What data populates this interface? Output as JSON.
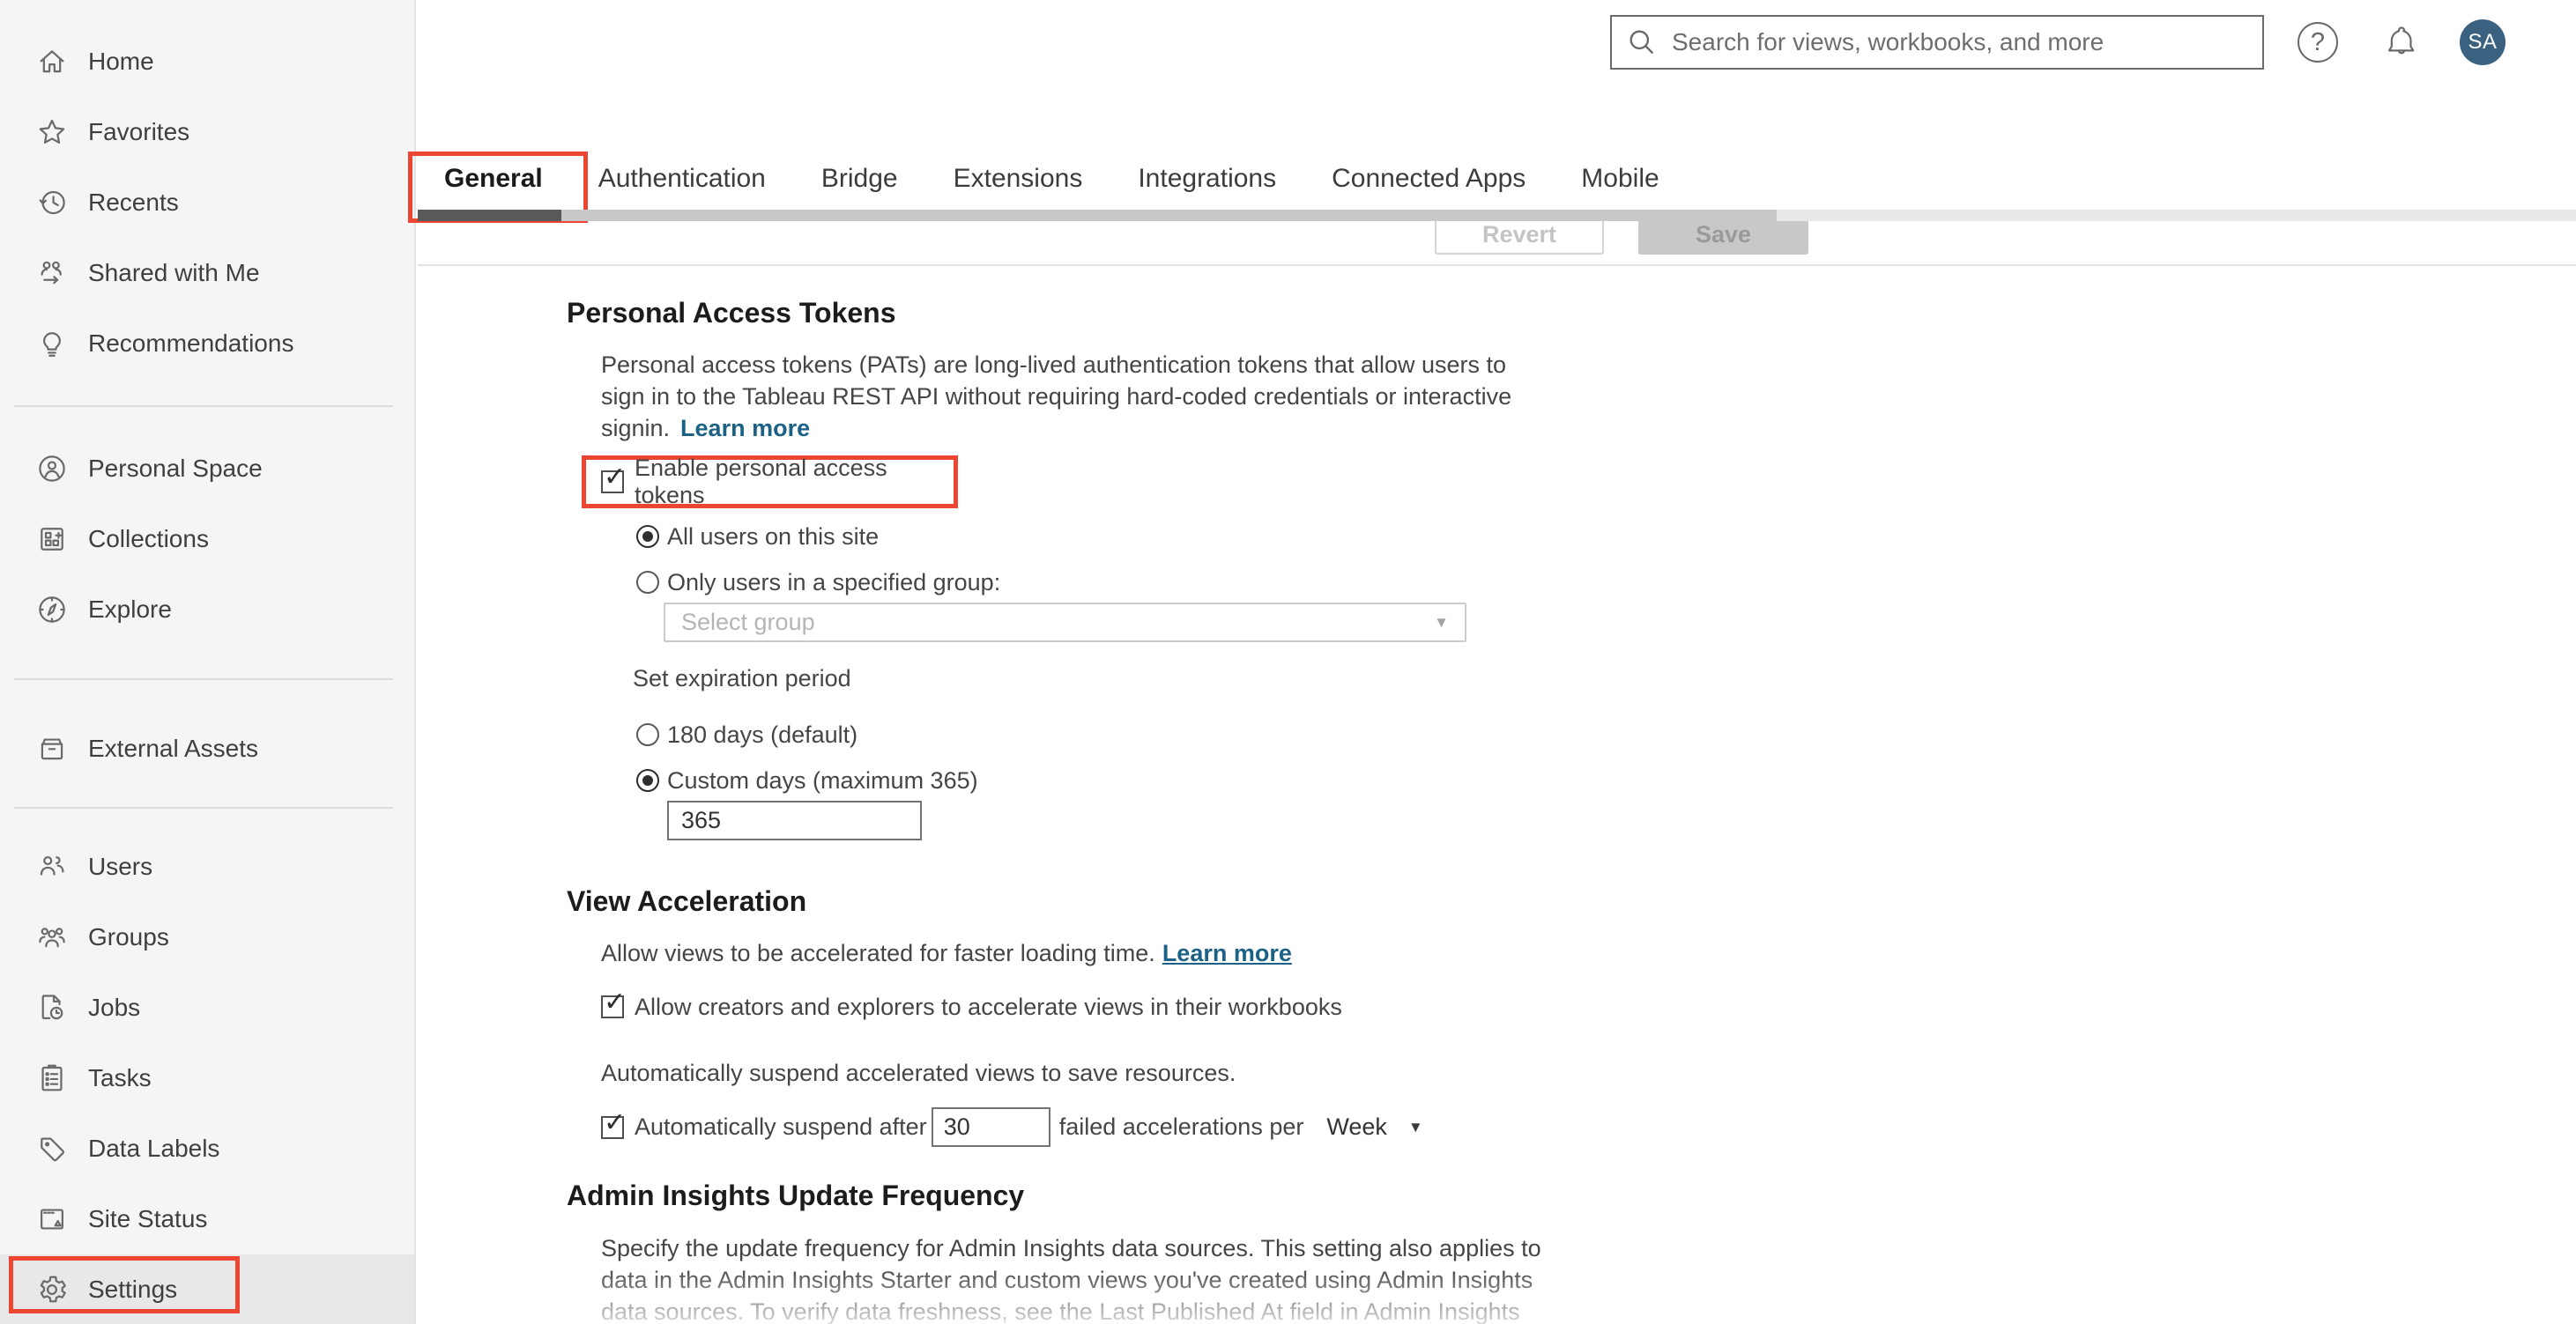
{
  "header": {
    "search_placeholder": "Search for views, workbooks, and more",
    "avatar_initials": "SA",
    "help_glyph": "?"
  },
  "icons": {
    "check": "✓",
    "caret_down": "▼"
  },
  "colors": {
    "annotation_red": "#ec4632",
    "link_blue": "#1c6286",
    "avatar_bg": "#3a617f",
    "sidebar_bg": "#f5f5f5",
    "active_tab_indicator": "#595959"
  },
  "sidebar": {
    "items": [
      {
        "label": "Home"
      },
      {
        "label": "Favorites"
      },
      {
        "label": "Recents"
      },
      {
        "label": "Shared with Me"
      },
      {
        "label": "Recommendations"
      },
      {
        "label": "Personal Space"
      },
      {
        "label": "Collections"
      },
      {
        "label": "Explore"
      },
      {
        "label": "External Assets"
      },
      {
        "label": "Users"
      },
      {
        "label": "Groups"
      },
      {
        "label": "Jobs"
      },
      {
        "label": "Tasks"
      },
      {
        "label": "Data Labels"
      },
      {
        "label": "Site Status"
      },
      {
        "label": "Settings"
      }
    ]
  },
  "tabs": {
    "items": [
      {
        "label": "General",
        "active": true
      },
      {
        "label": "Authentication"
      },
      {
        "label": "Bridge"
      },
      {
        "label": "Extensions"
      },
      {
        "label": "Integrations"
      },
      {
        "label": "Connected Apps"
      },
      {
        "label": "Mobile"
      }
    ],
    "revert_label": "Revert",
    "save_label": "Save"
  },
  "sections": {
    "pat": {
      "title": "Personal Access Tokens",
      "description": "Personal access tokens (PATs) are long-lived authentication tokens that allow users to\nsign in to the Tableau REST API without requiring hard-coded credentials or interactive\nsignin.",
      "learn_more": "Learn more",
      "enable_label": "Enable personal access tokens",
      "radio_all_users": "All users on this site",
      "radio_specified_group": "Only users in a specified group:",
      "group_placeholder": "Select group",
      "expiration_label": "Set expiration period",
      "radio_180_days": "180 days (default)",
      "radio_custom_days": "Custom days (maximum 365)",
      "custom_days_value": "365"
    },
    "view_accel": {
      "title": "View Acceleration",
      "intro": "Allow views to be accelerated for faster loading time.",
      "learn_more": "Learn more",
      "allow_label": "Allow creators and explorers to accelerate views in their workbooks",
      "suspend_note": "Automatically suspend accelerated views to save resources.",
      "suspend_prefix": "Automatically suspend after",
      "suspend_value": "30",
      "suspend_suffix": "failed accelerations per",
      "period_value": "Week"
    },
    "admin_insights": {
      "title": "Admin Insights Update Frequency",
      "description": "Specify the update frequency for Admin Insights data sources. This setting also applies to\ndata in the Admin Insights Starter and custom views you've created using Admin Insights\ndata sources. To verify data freshness, see the Last Published At field in Admin Insights"
    }
  }
}
